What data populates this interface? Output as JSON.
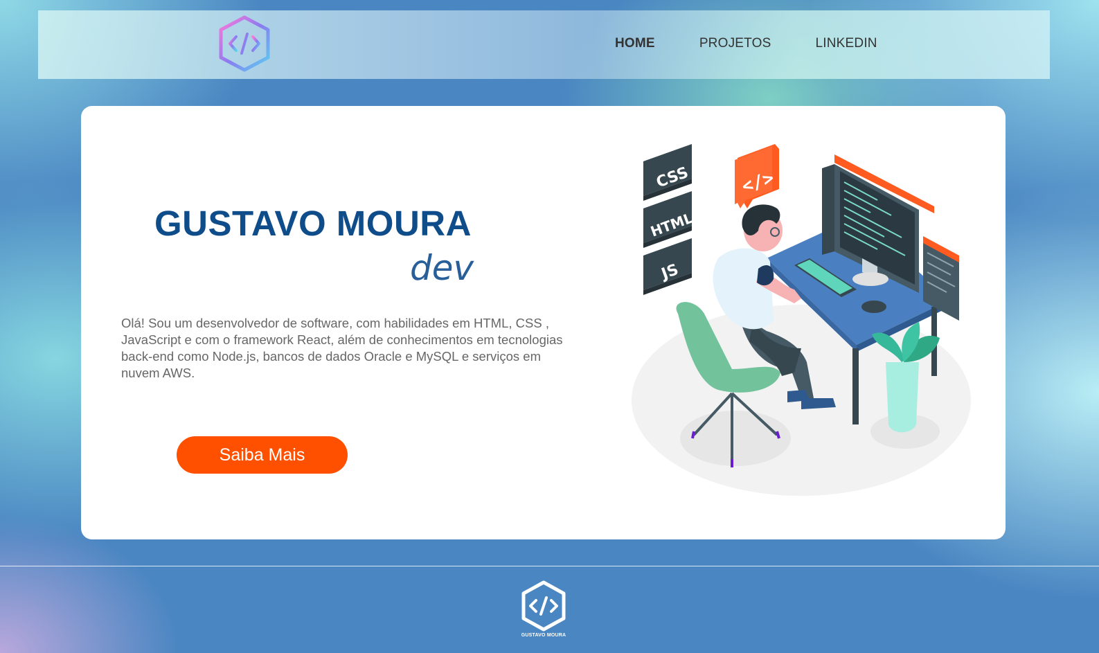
{
  "header": {
    "nav": [
      {
        "label": "HOME",
        "active": true
      },
      {
        "label": "PROJETOS",
        "active": false
      },
      {
        "label": "LINKEDIN",
        "active": false
      }
    ],
    "logo_icon": "code-hexagon-icon"
  },
  "hero": {
    "name": "GUSTAVO MOURA",
    "role": "dev",
    "bio": "Olá! Sou um desenvolvedor de software, com habilidades em HTML, CSS , JavaScript e com o framework React, além de conhecimentos em tecnologias back-end como Node.js, bancos de dados Oracle e MySQL e serviços em nuvem AWS.",
    "cta_label": "Saiba Mais",
    "illustration": {
      "badges": [
        "CSS",
        "HTML",
        "JS"
      ],
      "code_tag": "</>"
    }
  },
  "footer": {
    "logo_label": "GUSTAVO MOURA"
  },
  "colors": {
    "accent": "#ff5000",
    "name_blue": "#0f4c8a",
    "background_blue": "#4a86c2"
  }
}
